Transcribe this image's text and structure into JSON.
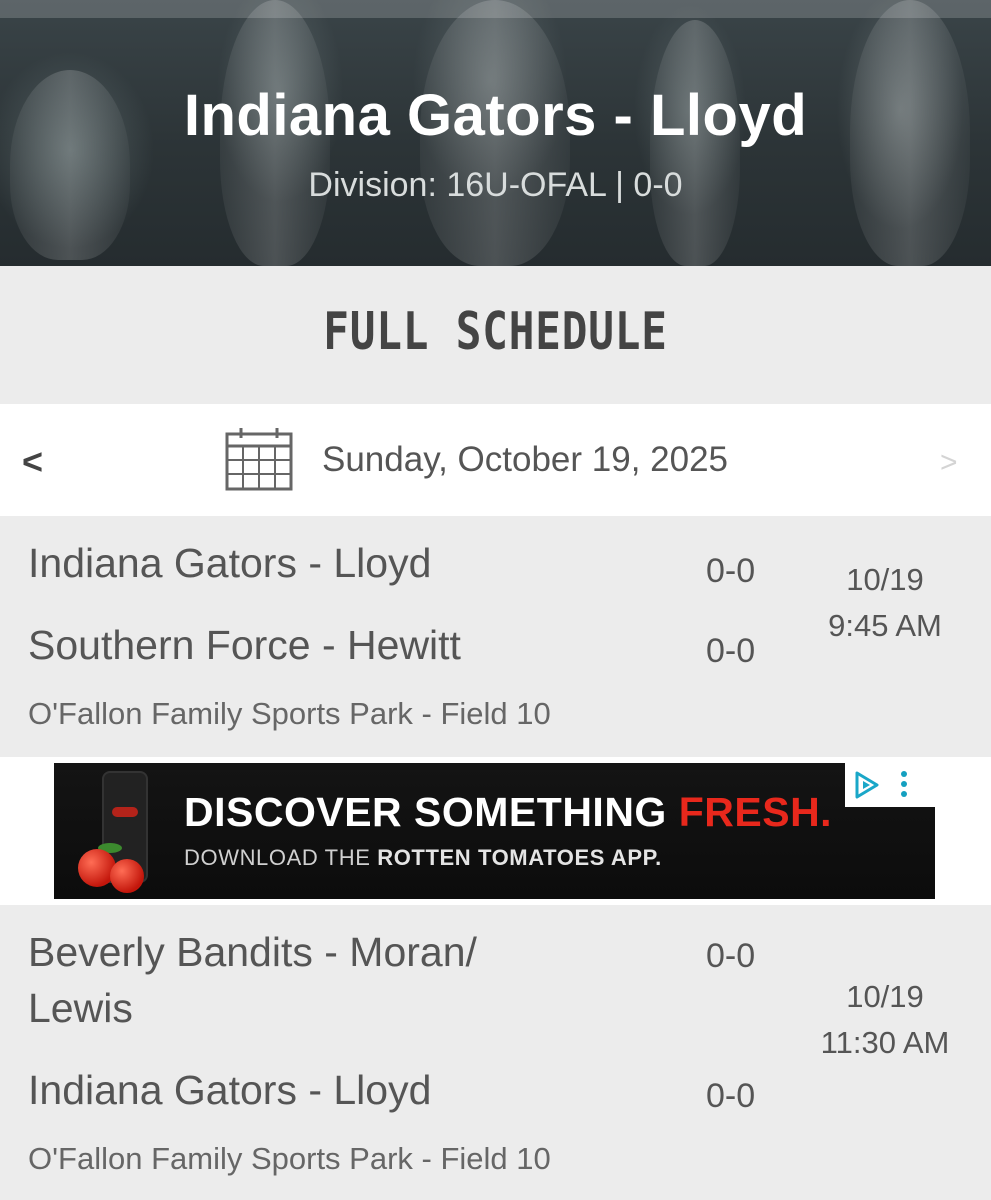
{
  "header": {
    "team_title": "Indiana Gators - Lloyd",
    "subtitle": "Division: 16U-OFAL | 0-0"
  },
  "section_title": "FULL SCHEDULE",
  "date_nav": {
    "prev_label": "<",
    "next_label": ">",
    "date": "Sunday, October 19, 2025",
    "icon": "calendar-icon"
  },
  "games": [
    {
      "home_team": "Indiana Gators - Lloyd",
      "home_record": "0-0",
      "away_team": "Southern Force - Hewitt",
      "away_record": "0-0",
      "date": "10/19",
      "time": "9:45 AM",
      "venue": "O'Fallon Family Sports Park - Field 10"
    },
    {
      "home_team_line1": "Beverly Bandits - Moran/",
      "home_team_line2": "Lewis",
      "home_record": "0-0",
      "away_team": "Indiana Gators - Lloyd",
      "away_record": "0-0",
      "date": "10/19",
      "time": "11:30 AM",
      "venue": "O'Fallon Family Sports Park - Field 10"
    }
  ],
  "ad": {
    "headline_main": "DISCOVER SOMETHING ",
    "headline_accent": "FRESH.",
    "sub_prefix": "DOWNLOAD THE ",
    "sub_brand": "ROTTEN TOMATOES APP.",
    "accent_color": "#e8281c",
    "choices_icon": "ad-choices-icon",
    "menu_icon": "more-vertical-icon"
  }
}
